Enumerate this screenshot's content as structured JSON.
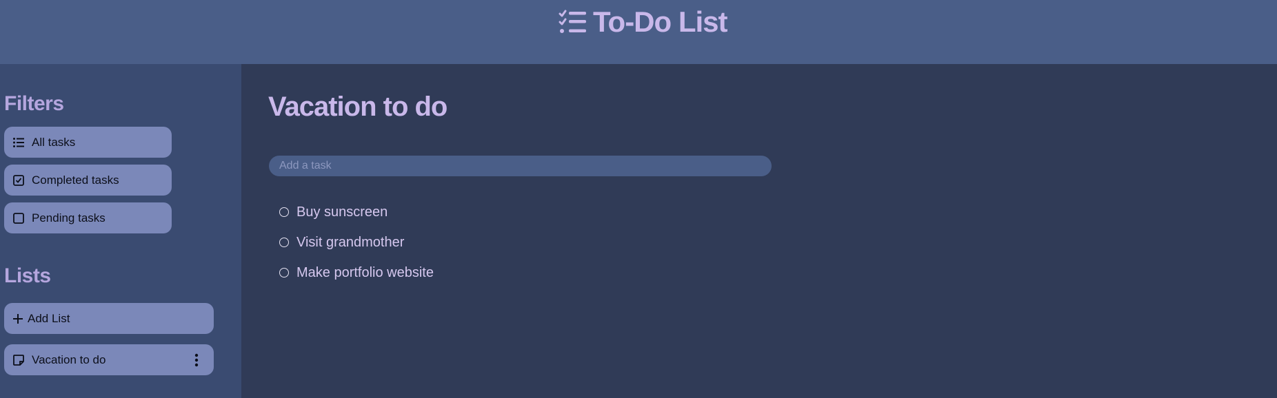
{
  "app": {
    "title": "To-Do List",
    "icon": "task-list-check-icon"
  },
  "sidebar": {
    "filters_title": "Filters",
    "filters": [
      {
        "label": "All tasks",
        "icon": "list-icon"
      },
      {
        "label": "Completed tasks",
        "icon": "checked-square-icon"
      },
      {
        "label": "Pending tasks",
        "icon": "empty-square-icon"
      }
    ],
    "lists_title": "Lists",
    "add_list_label": "Add List",
    "lists": [
      {
        "label": "Vacation to do",
        "icon": "note-icon"
      }
    ]
  },
  "main": {
    "title": "Vacation to do",
    "add_task_placeholder": "Add a task",
    "tasks": [
      {
        "text": "Buy sunscreen",
        "completed": false
      },
      {
        "text": "Visit grandmother",
        "completed": false
      },
      {
        "text": "Make portfolio website",
        "completed": false
      }
    ]
  },
  "colors": {
    "header_bg": "#4a5e88",
    "sidebar_bg": "#3a4b71",
    "main_bg": "#303b57",
    "pill_bg": "#7b88b9",
    "accent_text": "#c9b8ea"
  }
}
